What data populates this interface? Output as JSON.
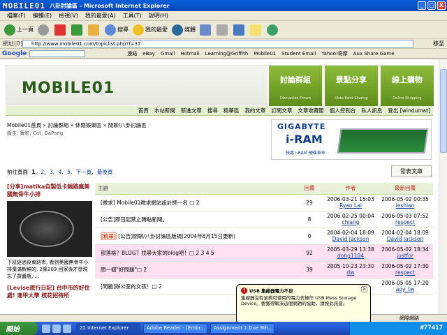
{
  "window": {
    "logo": "MOBILE01",
    "title": "八卦討論區 - Microsoft Internet Explorer",
    "min": "_",
    "max": "□",
    "close": "X"
  },
  "menu": [
    "檔案(F)",
    "編輯(E)",
    "檢視(V)",
    "我的最愛(A)",
    "工具(T)",
    "說明(H)"
  ],
  "toolbar": {
    "back": "上一頁",
    "search": "搜尋",
    "favorites": "我的最愛",
    "media": "媒體"
  },
  "address": {
    "label": "網址(D)",
    "url": "http://www.mobile01.com/topiclist.php?f=37",
    "go": "移至"
  },
  "google_bar": {
    "label": "Google",
    "links": [
      "連結",
      "eBay",
      "Gmail",
      "Hotmail",
      "Learning@Griffith",
      "Mobile01",
      "Student Email",
      "Yahoo!奇摩",
      "Aux Share Game"
    ]
  },
  "site": {
    "logo": "MOBILE01",
    "tabs": [
      {
        "big": "討論群組",
        "small": "Discussion Forum"
      },
      {
        "big": "景點分享",
        "small": "Vista Point Sharing"
      },
      {
        "big": "線上購物",
        "small": "Online Shopping"
      }
    ],
    "subnav": [
      "首頁",
      "本站新聞",
      "新進文章",
      "搜尋",
      "精華區",
      "我的文章",
      "訂閱文章",
      "文章收藏匣",
      "個人控制台",
      "私人訊息",
      "登出 [windumat]"
    ],
    "breadcrumb": "Mobile01首頁 » 討論群組 » 休閒娛樂區 » 閒聊/八卦討論區",
    "moderators": "版主: 舞影, Cat, DaPang",
    "banner": {
      "brand": "GIGABYTE",
      "product": "i-RAM",
      "tagline": "技嘉 i-RAM 硬碟革命"
    },
    "pager": {
      "prefix": "前往頁面",
      "pages": [
        "1",
        "2",
        "3",
        "4",
        "5"
      ],
      "next": "下一頁",
      "last": "最後頁"
    },
    "post_button": "發表文章"
  },
  "sidebar": {
    "item1_title": "[分享]matika自製低卡鍋路瘋美國無骨牛小排",
    "item1_desc": "下班經過後東路市, 看到美國無骨牛小排還滿新鮮的, 2條209 回家後才發現忘了買醬瓶, ...",
    "item2_title": "[Levise旅行日記] 台中市的好住處! 逢甲大學 校花招待所"
  },
  "table": {
    "headers": {
      "subject": "主題",
      "replies": "回覆",
      "author": "作者",
      "last": "最新回覆"
    },
    "rows": [
      {
        "subject": "[徵求] Mobile01徵求網站設計師一名 □ 2",
        "replies": "29",
        "author_date": "2006-03-21 15:03",
        "author": "Ryan Lai",
        "last_date": "2006-05-02 00:35",
        "last": "ieshian",
        "pink": false
      },
      {
        "subject": "[公告]即日起禁止轉貼新聞。",
        "replies": "8",
        "author_date": "2006-02-25 00:04",
        "author": "chiang",
        "last_date": "2006-05-03 07:52",
        "last": "respect",
        "pink": false
      },
      {
        "subject": "[公告]閒聊/八卦討論區版規(2004年8月15日更新)",
        "tag": "[精華]",
        "replies": "0",
        "author_date": "2004-02-04 18:09",
        "author": "David Jackson",
        "last_date": "2004-02-04 18:09",
        "last": "David Jackson",
        "pink": false
      },
      {
        "subject": "部落格？BLOG？找尋大家的blog吧！□ 2 3 4 5",
        "replies": "92",
        "author_date": "2005-03-29 13:38",
        "author": "dong1104",
        "last_date": "2006-05-02 18:34",
        "last": "justfor",
        "pink": true
      },
      {
        "subject": "問一個\"好問題\"□ 2",
        "replies": "39",
        "author_date": "2005-10-23 23:30",
        "author": "dw",
        "last_date": "2006-05-02 17:30",
        "last": "respect",
        "pink": true
      },
      {
        "subject": "[問題]辦公室的女孩！□ 2",
        "replies": "",
        "author_date": "",
        "author": "",
        "last_date": "2006-05-05 17:20",
        "last": "aoy_tw",
        "pink": false
      }
    ]
  },
  "balloon": {
    "title": "USB 集線器電力不足",
    "body": "集線器沒有足夠可使用的電力去操作 USB Mass Storage Device。要獲得解決這個問題的協助，請按此訊息。"
  },
  "status": {
    "zone": "網際網路"
  },
  "taskbar": {
    "start": "開始",
    "tasks": [
      "22 Internet Explorer",
      "Adobe Reader - [Embr...",
      "Assignment 1 Due 8th..."
    ],
    "watermark": "#77417"
  }
}
